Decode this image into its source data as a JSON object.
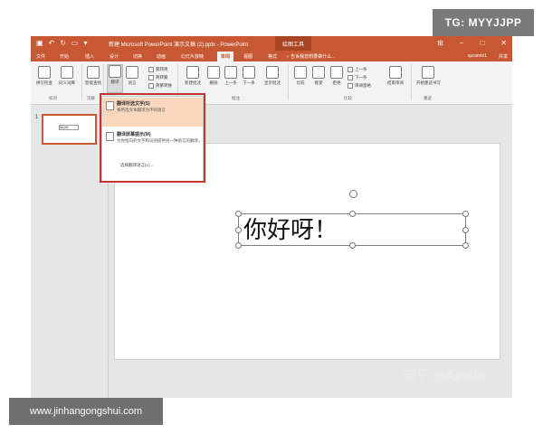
{
  "watermarks": {
    "top_right": "TG: MYYJJPP",
    "bottom_left": "www.jinhangongshui.com",
    "overlay": "知乎 @Apollo"
  },
  "titlebar": {
    "doc_title": "新建 Microsoft PowerPoint 演示文稿 (2).pptx - PowerPoint",
    "context_tools": "绘图工具"
  },
  "tabs": [
    "文件",
    "开始",
    "插入",
    "设计",
    "切换",
    "动画",
    "幻灯片放映",
    "审阅",
    "视图",
    "格式"
  ],
  "active_tab_index": 7,
  "tellme": "♀ 告诉我您想要做什么...",
  "account": {
    "user": "quranno1",
    "share": "共享"
  },
  "ribbon": {
    "proofing": {
      "spell": "拼写检查",
      "thesaurus": "同义词库",
      "group": "校对"
    },
    "insights": {
      "smart": "智能查找",
      "group": "见解"
    },
    "translate": "翻译",
    "language": "语言",
    "chinese": {
      "to_simplified": "繁转简",
      "to_traditional": "简转繁",
      "convert": "简繁转换"
    },
    "comments": {
      "new": "新建批注",
      "delete": "删除",
      "prev": "上一条",
      "next": "下一条",
      "show": "显示批注",
      "group": "批注"
    },
    "compare": {
      "compare": "比较",
      "accept": "接受",
      "reject": "拒绝",
      "prev": "上一条",
      "next": "下一条",
      "pane": "审阅窗格",
      "end": "结束审阅",
      "group": "比较"
    },
    "ink": {
      "label": "开始墨迹书写",
      "group": "墨迹"
    }
  },
  "menu": {
    "item1_title": "翻译所选文字(S)",
    "item1_desc": "将所选文本翻译为不同语言",
    "item2_title": "翻译屏幕提示(M)",
    "item2_desc": "为你指向的文字和词语提供另一种语言的翻译。",
    "options": "选择翻译语言(L)..."
  },
  "thumbnail": {
    "number": "1",
    "text": "你好呀！"
  },
  "slide": {
    "text": "你好呀！"
  }
}
